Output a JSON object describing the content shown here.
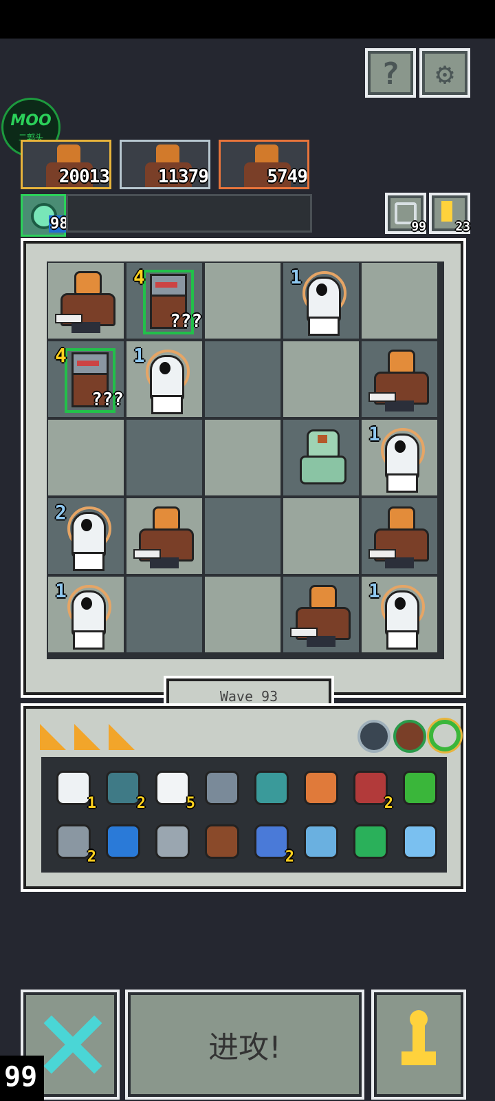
{
  "header": {
    "help_label": "?",
    "settings_label": "⚙"
  },
  "watermark": {
    "line1": "MOO",
    "line2": "二郭头"
  },
  "enemies": [
    {
      "hp": "20013",
      "border": "#e8b43b"
    },
    {
      "hp": "11379",
      "border": "#b7c7d0"
    },
    {
      "hp": "5749",
      "border": "#e8743b"
    }
  ],
  "resources": {
    "gem_count": "98",
    "reroll_count": "99",
    "key_count": "23"
  },
  "board": {
    "rows": [
      [
        {
          "u": "brute"
        },
        {
          "u": "knight",
          "lvl": "4",
          "q": "???"
        },
        {
          "u": ""
        },
        {
          "u": "ghost",
          "lvl": "1"
        },
        {
          "u": ""
        }
      ],
      [
        {
          "u": "knight",
          "lvl": "4",
          "q": "???"
        },
        {
          "u": "ghost",
          "lvl": "1"
        },
        {
          "u": ""
        },
        {
          "u": ""
        },
        {
          "u": "brute"
        }
      ],
      [
        {
          "u": ""
        },
        {
          "u": ""
        },
        {
          "u": ""
        },
        {
          "u": "zombie"
        },
        {
          "u": "ghost",
          "lvl": "1"
        }
      ],
      [
        {
          "u": "ghost",
          "lvl": "2"
        },
        {
          "u": "brute"
        },
        {
          "u": ""
        },
        {
          "u": ""
        },
        {
          "u": "brute"
        }
      ],
      [
        {
          "u": "ghost",
          "lvl": "1"
        },
        {
          "u": ""
        },
        {
          "u": ""
        },
        {
          "u": "brute"
        },
        {
          "u": "ghost",
          "lvl": "1"
        }
      ]
    ]
  },
  "wave": {
    "label": "Wave  93"
  },
  "inventory": {
    "row1": [
      {
        "icon": "bone-icon",
        "count": "1"
      },
      {
        "icon": "heart-shield-icon",
        "count": "2"
      },
      {
        "icon": "cloud-icon",
        "count": "5"
      },
      {
        "icon": "rock-icon",
        "count": ""
      },
      {
        "icon": "gauntlet-icon",
        "count": ""
      },
      {
        "icon": "swirl-orb-icon",
        "count": ""
      },
      {
        "icon": "mimic-mouth-icon",
        "count": "2"
      },
      {
        "icon": "potion-bag-icon",
        "count": ""
      }
    ],
    "row2": [
      {
        "icon": "robot-icon",
        "count": "2"
      },
      {
        "icon": "battery-icon",
        "count": ""
      },
      {
        "icon": "chain-icon",
        "count": ""
      },
      {
        "icon": "chest-icon",
        "count": ""
      },
      {
        "icon": "magnet-swap-icon",
        "count": "2"
      },
      {
        "icon": "flask-icon",
        "count": ""
      },
      {
        "icon": "slime-jar-icon",
        "count": ""
      },
      {
        "icon": "network-icon",
        "count": ""
      }
    ]
  },
  "actions": {
    "attack_label": "进攻!",
    "corner_count": "99"
  }
}
